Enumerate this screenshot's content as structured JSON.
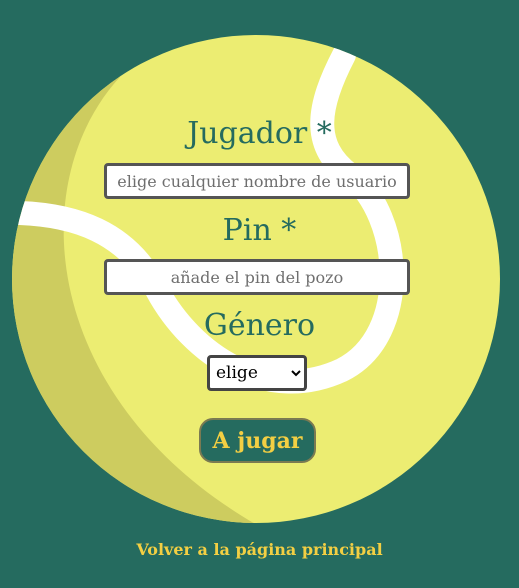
{
  "form": {
    "player": {
      "label": "Jugador *",
      "placeholder": "elige cualquier nombre de usuario",
      "value": ""
    },
    "pin": {
      "label": "Pin *",
      "placeholder": "añade el pin del pozo",
      "value": ""
    },
    "gender": {
      "label": "Género",
      "selected": "elige"
    },
    "submit_label": "A jugar"
  },
  "footer": {
    "back_link": "Volver a la página principal"
  },
  "colors": {
    "background": "#256b5f",
    "ball": "#eced72",
    "ball_shadow": "#cdcc5f",
    "seam": "#ffffff",
    "accent": "#f3cf43",
    "label": "#256b5f"
  }
}
